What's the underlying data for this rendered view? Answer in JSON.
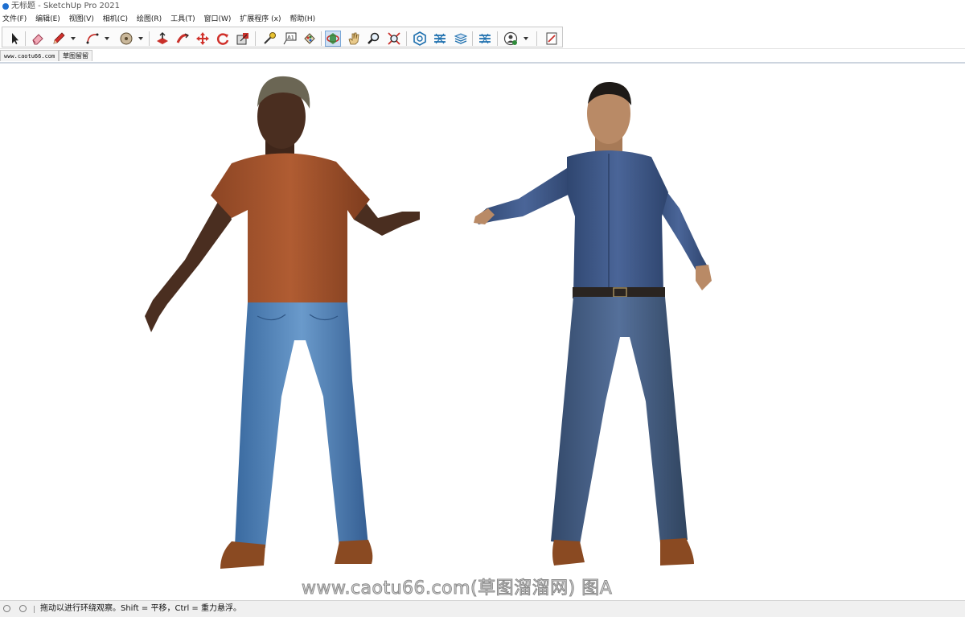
{
  "window": {
    "title": "无标题 - SketchUp Pro 2021"
  },
  "menu": {
    "items": [
      "文件(F)",
      "编辑(E)",
      "视图(V)",
      "相机(C)",
      "绘图(R)",
      "工具(T)",
      "窗口(W)",
      "扩展程序 (x)",
      "帮助(H)"
    ]
  },
  "toolbar": {
    "tools": [
      "select-tool",
      "eraser-tool",
      "pencil-tool",
      "arc-tool",
      "paint-bucket-tool",
      "push-pull-tool",
      "follow-me-tool",
      "move-tool",
      "rotate-tool",
      "scale-tool",
      "tape-measure-tool",
      "text-tool",
      "paint-tool",
      "orbit-tool",
      "pan-tool",
      "zoom-tool",
      "zoom-extents-tool",
      "warehouse-tool",
      "extension-warehouse-tool",
      "layout-tool",
      "send-to-layout-tool",
      "account-tool",
      "sketch-tool"
    ],
    "active_tool": "orbit-tool",
    "text_tool_glyph": "A1"
  },
  "tabs": [
    "www.caotu66.com",
    "草图留留"
  ],
  "viewport": {
    "watermark": "www.caotu66.com(草图溜溜网) 图A",
    "colors": {
      "shirt_left": "#a4532c",
      "jeans_left": "#4a7fb6",
      "shirt_right": "#3b5584",
      "jeans_right": "#3e5576",
      "skin_left": "#4a2e20",
      "skin_right": "#b98a66",
      "shoes": "#8a4a22"
    }
  },
  "status": {
    "message": "拖动以进行环绕观察。Shift = 平移，Ctrl = 重力悬浮。"
  }
}
